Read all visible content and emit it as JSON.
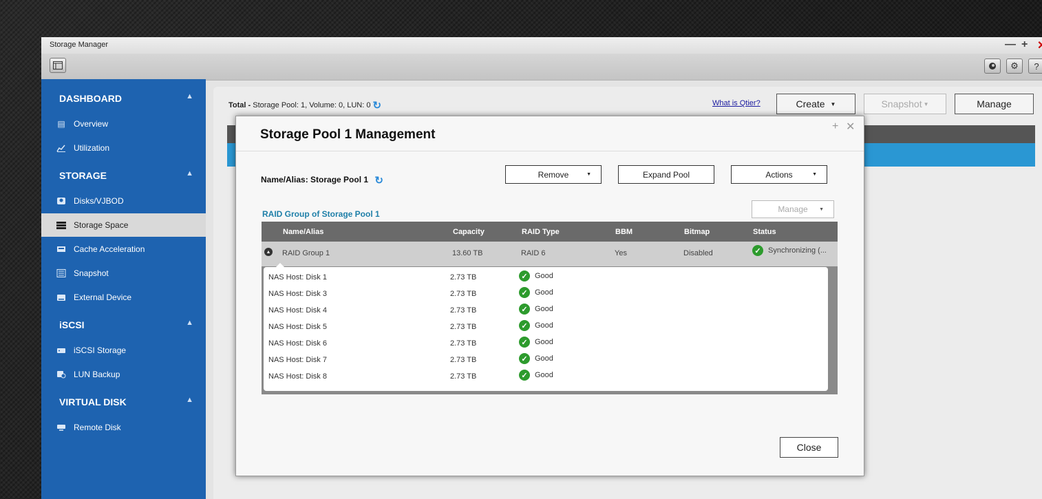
{
  "window": {
    "title": "Storage Manager",
    "controls": {
      "minimize": "—",
      "maximize": "+",
      "close": "✕"
    }
  },
  "toolbar": {
    "help": "?"
  },
  "sidebar": {
    "sections": [
      {
        "label": "DASHBOARD",
        "items": [
          "Overview",
          "Utilization"
        ]
      },
      {
        "label": "STORAGE",
        "items": [
          "Disks/VJBOD",
          "Storage Space",
          "Cache Acceleration",
          "Snapshot",
          "External Device"
        ]
      },
      {
        "label": "iSCSI",
        "items": [
          "iSCSI Storage",
          "LUN Backup"
        ]
      },
      {
        "label": "VIRTUAL DISK",
        "items": [
          "Remote Disk"
        ]
      }
    ],
    "selected": "Storage Space"
  },
  "content": {
    "total_label": "Total -",
    "total_value": "Storage Pool: 1, Volume: 0, LUN: 0",
    "what_is_link": "What is Qtier?",
    "create_label": "Create",
    "snapshot_label": "Snapshot",
    "manage_label": "Manage"
  },
  "dialog": {
    "title": "Storage Pool 1 Management",
    "name_alias": "Name/Alias: Storage Pool 1",
    "remove_label": "Remove",
    "expand_label": "Expand Pool",
    "actions_label": "Actions",
    "raid_title": "RAID Group of Storage Pool 1",
    "manage_label": "Manage",
    "close_label": "Close",
    "columns": [
      "Name/Alias",
      "Capacity",
      "RAID Type",
      "BBM",
      "Bitmap",
      "Status"
    ],
    "raid_group": {
      "name": "RAID Group 1",
      "capacity": "13.60 TB",
      "raid_type": "RAID 6",
      "bbm": "Yes",
      "bitmap": "Disabled",
      "status": "Synchronizing (..."
    },
    "disks": [
      {
        "name": "NAS Host: Disk 1",
        "capacity": "2.73 TB",
        "status": "Good"
      },
      {
        "name": "NAS Host: Disk 3",
        "capacity": "2.73 TB",
        "status": "Good"
      },
      {
        "name": "NAS Host: Disk 4",
        "capacity": "2.73 TB",
        "status": "Good"
      },
      {
        "name": "NAS Host: Disk 5",
        "capacity": "2.73 TB",
        "status": "Good"
      },
      {
        "name": "NAS Host: Disk 6",
        "capacity": "2.73 TB",
        "status": "Good"
      },
      {
        "name": "NAS Host: Disk 7",
        "capacity": "2.73 TB",
        "status": "Good"
      },
      {
        "name": "NAS Host: Disk 8",
        "capacity": "2.73 TB",
        "status": "Good"
      }
    ]
  },
  "colors": {
    "sidebar": "#1e63b0",
    "accent_teal": "#1e7fa8",
    "status_good": "#2d9b2d"
  }
}
